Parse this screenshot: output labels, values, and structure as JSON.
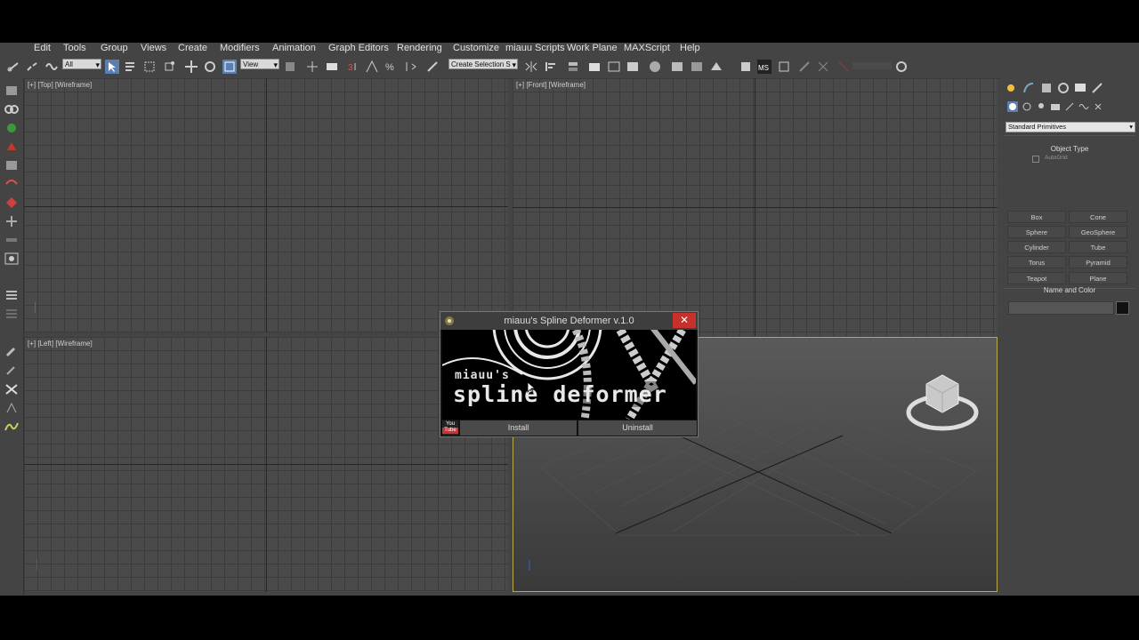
{
  "menu": [
    "Edit",
    "Tools",
    "Group",
    "Views",
    "Create",
    "Modifiers",
    "Animation",
    "Graph Editors",
    "Rendering",
    "Customize",
    "miauu Scripts",
    "Work Plane",
    "MAXScript",
    "Help"
  ],
  "toolbar": {
    "selection_filter": "All",
    "ref_coord": "View",
    "named_selection": "Create Selection S"
  },
  "viewports": {
    "top": "[+] [Top] [Wireframe]",
    "front": "[+] [Front] [Wireframe]",
    "left": "[+] [Left] [Wireframe]"
  },
  "panel": {
    "category": "Standard Primitives",
    "object_type_title": "Object Type",
    "autogrid": "AutoGrid",
    "buttons": [
      "Box",
      "Cone",
      "Sphere",
      "GeoSphere",
      "Cylinder",
      "Tube",
      "Torus",
      "Pyramid",
      "Teapot",
      "Plane"
    ],
    "name_color_title": "Name and Color",
    "object_color": "#111111"
  },
  "dialog": {
    "title": "miauu's Spline Deformer v.1.0",
    "close": "✕",
    "banner_small": "miauu's",
    "banner_big": "spline deformer",
    "youtube_top": "You",
    "youtube_bottom": "Tube",
    "install": "Install",
    "uninstall": "Uninstall"
  },
  "colors": {
    "ui_bg": "#444444",
    "viewport_bg": "#4a4a4a",
    "close_red": "#c8302c",
    "active_viewport_border": "#b9a94f"
  }
}
